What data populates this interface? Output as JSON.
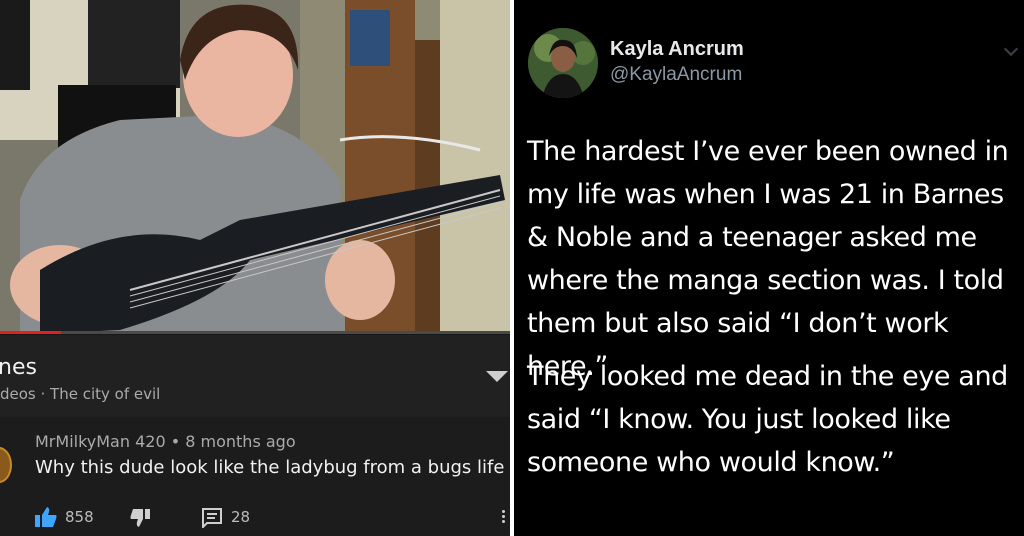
{
  "youtube": {
    "video_title": "nes",
    "video_subtitle": "deos · The city of evil",
    "progress": 0.12,
    "comment": {
      "author": "MrMilkyMan 420",
      "separator": "•",
      "time": "8 months ago",
      "text": "Why this dude look like the ladybug from a bugs life",
      "likes": "858",
      "replies": "28"
    },
    "icons": [
      "thumbs-up-icon",
      "thumbs-down-icon",
      "reply-icon",
      "more-vert-icon",
      "expand-caret-icon"
    ]
  },
  "tweet": {
    "display_name": "Kayla Ancrum",
    "handle": "@KaylaAncrum",
    "paragraphs": [
      "The hardest I’ve ever been owned in my life was when I was 21 in Barnes & Noble and a teenager asked me where the manga section was. I told them but also said “I don’t work here.”",
      "They looked me dead in the eye and said  “I know. You just looked like someone who would know.”"
    ]
  },
  "colors": {
    "youtube_bg": "#212121",
    "progress_red": "#e0221c",
    "like_blue": "#3ea6ff",
    "tweet_bg": "#000000"
  }
}
